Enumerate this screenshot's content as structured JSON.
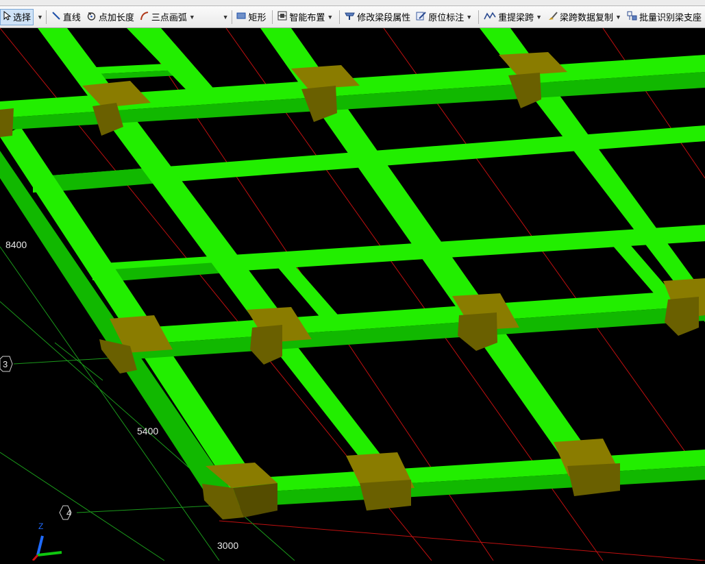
{
  "toolbar": {
    "select": "选择",
    "line": "直线",
    "point_length": "点加长度",
    "three_point_arc": "三点画弧",
    "rect": "矩形",
    "smart_layout": "智能布置",
    "modify_segment": "修改梁段属性",
    "in_place_mark": "原位标注",
    "re_extract_span": "重提梁跨",
    "span_copy": "梁跨数据复制",
    "batch_identify": "批量识别梁支座"
  },
  "viewport": {
    "dim_labels": [
      "8400",
      "5400",
      "3000"
    ],
    "axis_labels": [
      "3",
      "4"
    ],
    "axis_gizmo_z": "Z",
    "colors": {
      "background": "#000000",
      "beam_top": "#22ee00",
      "beam_side": "#11b800",
      "column_top": "#8a7c00",
      "column_side": "#6a6000",
      "axis_line": "#d01010",
      "grid_line": "#1b9a1b"
    }
  }
}
